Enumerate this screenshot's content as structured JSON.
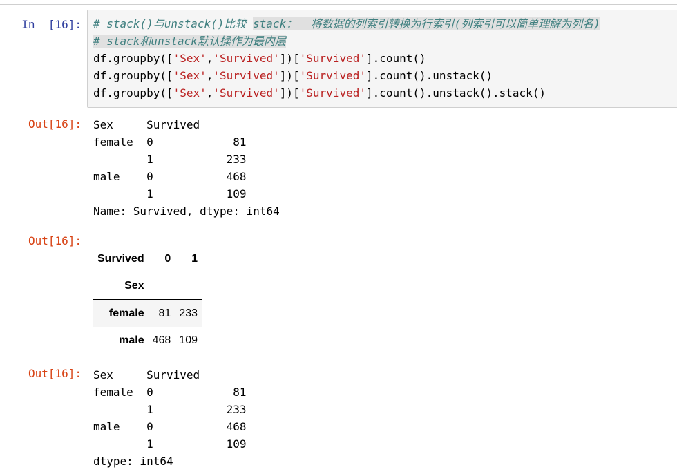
{
  "cell": {
    "in_prompt": "In  [16]:",
    "code_lines": [
      [
        {
          "t": "# stack()与unstack()比较 ",
          "c": "comment"
        },
        {
          "t": "stack：  将数据的列索引转换为行索引(列索引可以简单理解为列名)",
          "c": "comment-hl"
        }
      ],
      [
        {
          "t": "# stack和unstack默认操作为最内层",
          "c": "comment-hl"
        }
      ],
      [
        {
          "t": "df.groupby([",
          "c": "plain"
        },
        {
          "t": "'Sex'",
          "c": "string"
        },
        {
          "t": ",",
          "c": "plain"
        },
        {
          "t": "'Survived'",
          "c": "string"
        },
        {
          "t": "])[",
          "c": "plain"
        },
        {
          "t": "'Survived'",
          "c": "string"
        },
        {
          "t": "].count()",
          "c": "plain"
        }
      ],
      [
        {
          "t": "df.groupby([",
          "c": "plain"
        },
        {
          "t": "'Sex'",
          "c": "string"
        },
        {
          "t": ",",
          "c": "plain"
        },
        {
          "t": "'Survived'",
          "c": "string"
        },
        {
          "t": "])[",
          "c": "plain"
        },
        {
          "t": "'Survived'",
          "c": "string"
        },
        {
          "t": "].count().unstack()",
          "c": "plain"
        }
      ],
      [
        {
          "t": "df.groupby([",
          "c": "plain"
        },
        {
          "t": "'Sex'",
          "c": "string"
        },
        {
          "t": ",",
          "c": "plain"
        },
        {
          "t": "'Survived'",
          "c": "string"
        },
        {
          "t": "])[",
          "c": "plain"
        },
        {
          "t": "'Survived'",
          "c": "string"
        },
        {
          "t": "].count().unstack().stack()",
          "c": "plain"
        }
      ]
    ]
  },
  "outputs": {
    "out1": {
      "prompt": "Out[16]:",
      "lines": [
        "Sex     Survived",
        "female  0            81",
        "        1           233",
        "male    0           468",
        "        1           109",
        "Name: Survived, dtype: int64"
      ]
    },
    "out2": {
      "prompt": "Out[16]:",
      "columns_name": "Survived",
      "columns": [
        "0",
        "1"
      ],
      "index_name": "Sex",
      "rows": [
        {
          "index": "female",
          "values": [
            "81",
            "233"
          ]
        },
        {
          "index": "male",
          "values": [
            "468",
            "109"
          ]
        }
      ]
    },
    "out3": {
      "prompt": "Out[16]:",
      "lines": [
        "Sex     Survived",
        "female  0            81",
        "        1           233",
        "male    0           468",
        "        1           109",
        "dtype: int64"
      ]
    }
  },
  "colors": {
    "in_prompt": "#303f9f",
    "out_prompt": "#d84315",
    "comment": "#408080",
    "string": "#ba2121",
    "cell_bg": "#f5f5f5"
  }
}
